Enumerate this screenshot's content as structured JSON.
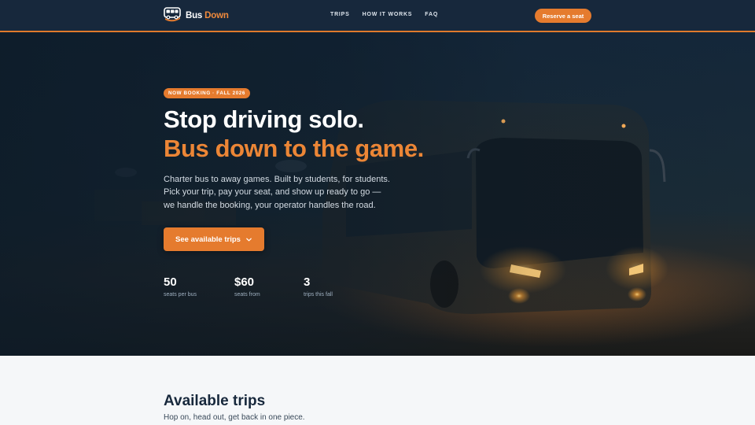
{
  "brand": {
    "name_part1": "Bus",
    "name_part2": "Down",
    "logo_icon": "bus-icon",
    "accent_color": "#e57b2e"
  },
  "nav": {
    "links": [
      {
        "label": "TRIPS"
      },
      {
        "label": "HOW IT WORKS"
      },
      {
        "label": "FAQ"
      }
    ],
    "cta_label": "Reserve a seat"
  },
  "hero": {
    "badge": "NOW BOOKING · FALL 2026",
    "headline_line1": "Stop driving solo.",
    "headline_line2": "Bus down to the game.",
    "lead_lines": [
      "Charter bus to away games. Built by students, for students.",
      "Pick your trip, pay your seat, and show up ready to go —",
      "we handle the booking, your operator handles the road."
    ],
    "cta_label": "See available trips",
    "cta_icon": "chevron-down-icon",
    "stats": [
      {
        "value": "50",
        "label": "seats per bus"
      },
      {
        "value": "$60",
        "label": "seats from"
      },
      {
        "value": "3",
        "label": "trips this fall"
      }
    ]
  },
  "trips_section": {
    "title": "Available trips",
    "subtitle": "Hop on, head out, get back in one piece."
  }
}
